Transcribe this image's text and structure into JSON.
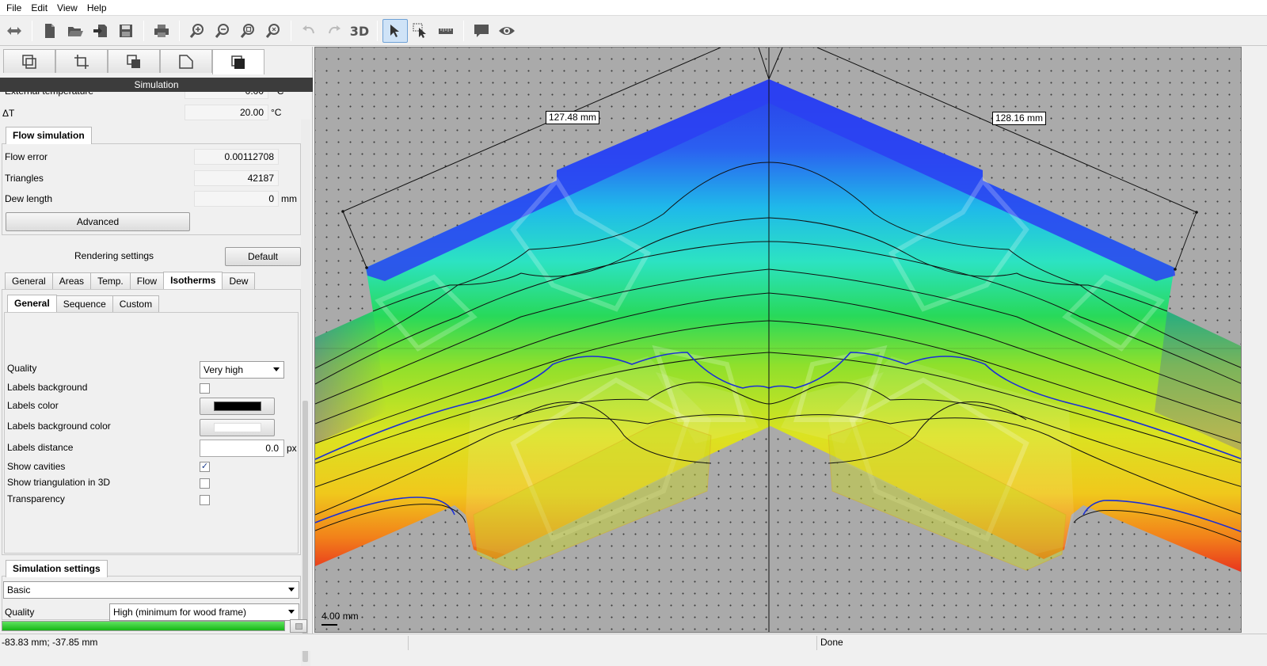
{
  "menu": {
    "items": [
      "File",
      "Edit",
      "View",
      "Help"
    ]
  },
  "toolbar": {
    "three_d_label": "3D",
    "icons": [
      "swap-arrows-icon",
      "new-file-icon",
      "open-folder-icon",
      "import-icon",
      "save-icon",
      "print-icon",
      "zoom-in-icon",
      "zoom-out-icon",
      "zoom-fit-icon",
      "zoom-window-icon",
      "undo-icon",
      "redo-icon",
      "3d-icon",
      "select-icon",
      "select-area-icon",
      "measure-icon",
      "comment-icon",
      "eye-icon"
    ]
  },
  "left_panel": {
    "section_title": "Simulation",
    "external_temperature": {
      "label": "External temperature",
      "value": "0.00",
      "unit": "°C"
    },
    "delta_t": {
      "label": "ΔT",
      "value": "20.00",
      "unit": "°C"
    },
    "flow_simulation": {
      "title": "Flow simulation",
      "flow_error": {
        "label": "Flow error",
        "value": "0.00112708"
      },
      "triangles": {
        "label": "Triangles",
        "value": "42187"
      },
      "dew_length": {
        "label": "Dew length",
        "value": "0",
        "unit": "mm"
      },
      "advanced_label": "Advanced"
    },
    "rendering": {
      "title": "Rendering settings",
      "default_label": "Default",
      "tabs": [
        "General",
        "Areas",
        "Temp.",
        "Flow",
        "Isotherms",
        "Dew"
      ],
      "active_tab": "Isotherms",
      "subtabs": [
        "General",
        "Sequence",
        "Custom"
      ],
      "active_subtab": "General",
      "quality_label": "Quality",
      "quality_value": "Very high",
      "labels_background_label": "Labels background",
      "labels_color_label": "Labels color",
      "labels_color": "#000000",
      "labels_bg_color_label": "Labels background color",
      "labels_bg_color": "#ffffff",
      "labels_distance_label": "Labels distance",
      "labels_distance_value": "0.0",
      "labels_distance_unit": "px",
      "show_cavities_label": "Show cavities",
      "show_triangulation_label": "Show triangulation in 3D",
      "transparency_label": "Transparency",
      "check_mark": "✓"
    },
    "simulation_settings": {
      "title": "Simulation settings",
      "mode_value": "Basic",
      "quality_label": "Quality",
      "quality_value": "High (minimum for wood frame)"
    },
    "progress": 1.0
  },
  "canvas": {
    "dim_left": "127.48 mm",
    "dim_right": "128.16 mm",
    "scale_label": "4.00 mm"
  },
  "statusbar": {
    "coords": "-83.83 mm; -37.85 mm",
    "status": "Done"
  }
}
